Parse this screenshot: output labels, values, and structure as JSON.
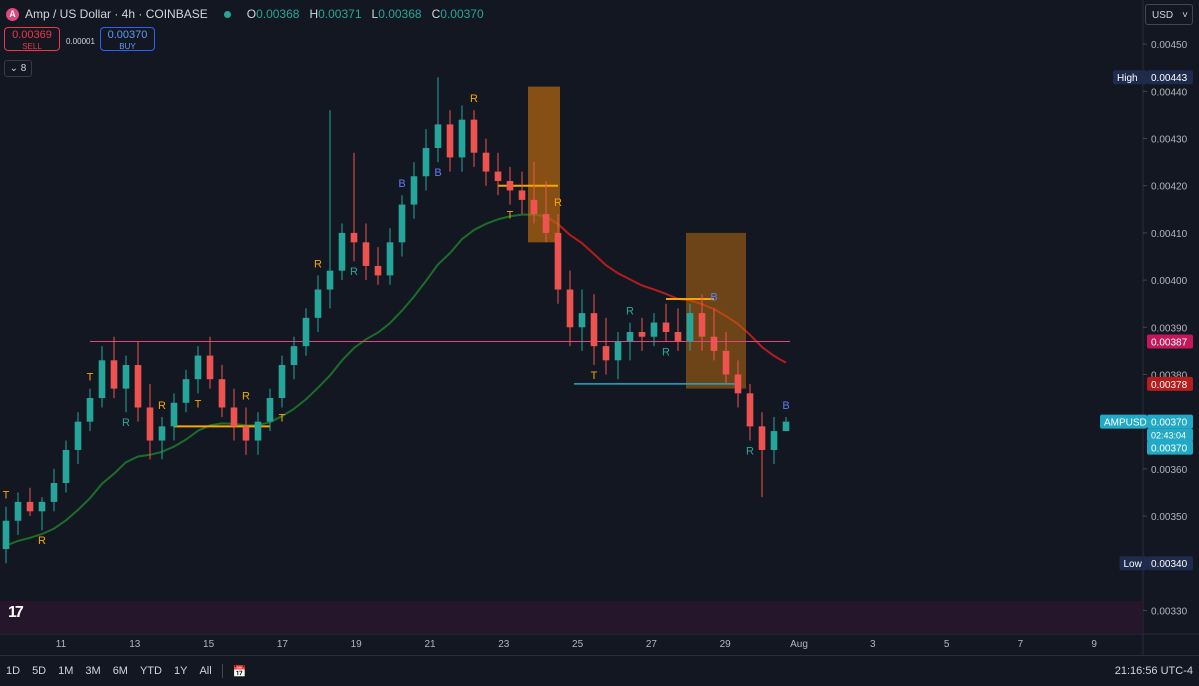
{
  "header": {
    "symbol_title": "Amp / US Dollar · 4h · COINBASE",
    "logo_letter": "A",
    "ohlc": [
      {
        "key": "O",
        "value": "0.00368"
      },
      {
        "key": "H",
        "value": "0.00371"
      },
      {
        "key": "L",
        "value": "0.00368"
      },
      {
        "key": "C",
        "value": "0.00370"
      }
    ]
  },
  "trade": {
    "sell_price": "0.00369",
    "sell_label": "SELL",
    "buy_price": "0.00370",
    "buy_label": "BUY",
    "spread": "0.00001"
  },
  "indicator_toggle": "8",
  "currency_select": "USD",
  "timeframes": [
    "1D",
    "5D",
    "1M",
    "3M",
    "6M",
    "YTD",
    "1Y",
    "All"
  ],
  "clock": "21:16:56 UTC-4",
  "colors": {
    "bg": "#131722",
    "up": "#26a69a",
    "down": "#ef5350",
    "gold": "#f7a600",
    "ema_green": "#1b6e2a",
    "ema_red": "#b71c1c",
    "magenta_line": "#e0457b",
    "cyan_line": "#22a9c5",
    "bands": "#b86a10"
  },
  "chart_data": {
    "type": "candlestick",
    "x_tick_labels": [
      "11",
      "13",
      "15",
      "17",
      "19",
      "21",
      "23",
      "25",
      "27",
      "29",
      "Aug",
      "3",
      "5",
      "7",
      "9"
    ],
    "y_tick_labels": [
      "0.00330",
      "0.00340",
      "0.00350",
      "0.00360",
      "0.00370",
      "0.00380",
      "0.00390",
      "0.00400",
      "0.00410",
      "0.00420",
      "0.00430",
      "0.00440",
      "0.00450"
    ],
    "ylim": [
      0.00325,
      0.00453
    ],
    "price_tags": [
      {
        "label": "High",
        "value": "0.00443"
      },
      {
        "label": "",
        "value": "0.00387"
      },
      {
        "label": "",
        "value": "0.00378"
      },
      {
        "label": "AMPUSD",
        "value": "0.00370",
        "countdown": "02:43:04"
      },
      {
        "label": "",
        "value": "0.00370"
      },
      {
        "label": "Low",
        "value": "0.00340"
      }
    ],
    "candles": [
      [
        0.00343,
        0.00352,
        0.0034,
        0.00349
      ],
      [
        0.00349,
        0.00355,
        0.00346,
        0.00353
      ],
      [
        0.00353,
        0.00356,
        0.0035,
        0.00351
      ],
      [
        0.00351,
        0.00354,
        0.00347,
        0.00353
      ],
      [
        0.00353,
        0.0036,
        0.00351,
        0.00357
      ],
      [
        0.00357,
        0.00366,
        0.00355,
        0.00364
      ],
      [
        0.00364,
        0.00372,
        0.00361,
        0.0037
      ],
      [
        0.0037,
        0.00377,
        0.00368,
        0.00375
      ],
      [
        0.00375,
        0.00386,
        0.00373,
        0.00383
      ],
      [
        0.00383,
        0.00388,
        0.00375,
        0.00377
      ],
      [
        0.00377,
        0.00384,
        0.00372,
        0.00382
      ],
      [
        0.00382,
        0.00387,
        0.0037,
        0.00373
      ],
      [
        0.00373,
        0.00378,
        0.00362,
        0.00366
      ],
      [
        0.00366,
        0.00371,
        0.00362,
        0.00369
      ],
      [
        0.00369,
        0.00376,
        0.00366,
        0.00374
      ],
      [
        0.00374,
        0.00381,
        0.00372,
        0.00379
      ],
      [
        0.00379,
        0.00386,
        0.00376,
        0.00384
      ],
      [
        0.00384,
        0.00388,
        0.00377,
        0.00379
      ],
      [
        0.00379,
        0.00382,
        0.00371,
        0.00373
      ],
      [
        0.00373,
        0.00377,
        0.00366,
        0.00369
      ],
      [
        0.00369,
        0.00373,
        0.00363,
        0.00366
      ],
      [
        0.00366,
        0.00372,
        0.00363,
        0.0037
      ],
      [
        0.0037,
        0.00377,
        0.00368,
        0.00375
      ],
      [
        0.00375,
        0.00384,
        0.00373,
        0.00382
      ],
      [
        0.00382,
        0.00388,
        0.00379,
        0.00386
      ],
      [
        0.00386,
        0.00394,
        0.00384,
        0.00392
      ],
      [
        0.00392,
        0.00401,
        0.00389,
        0.00398
      ],
      [
        0.00398,
        0.00436,
        0.00394,
        0.00402
      ],
      [
        0.00402,
        0.00412,
        0.004,
        0.0041
      ],
      [
        0.0041,
        0.00427,
        0.00404,
        0.00408
      ],
      [
        0.00408,
        0.00412,
        0.004,
        0.00403
      ],
      [
        0.00403,
        0.00407,
        0.00399,
        0.00401
      ],
      [
        0.00401,
        0.00411,
        0.00399,
        0.00408
      ],
      [
        0.00408,
        0.00418,
        0.00405,
        0.00416
      ],
      [
        0.00416,
        0.00425,
        0.00413,
        0.00422
      ],
      [
        0.00422,
        0.00432,
        0.00419,
        0.00428
      ],
      [
        0.00428,
        0.00443,
        0.00425,
        0.00433
      ],
      [
        0.00433,
        0.00436,
        0.00423,
        0.00426
      ],
      [
        0.00426,
        0.00437,
        0.00423,
        0.00434
      ],
      [
        0.00434,
        0.00436,
        0.00424,
        0.00427
      ],
      [
        0.00427,
        0.0043,
        0.0042,
        0.00423
      ],
      [
        0.00423,
        0.00427,
        0.00418,
        0.00421
      ],
      [
        0.00421,
        0.00424,
        0.00416,
        0.00419
      ],
      [
        0.00419,
        0.00423,
        0.00414,
        0.00417
      ],
      [
        0.00417,
        0.00425,
        0.00412,
        0.00414
      ],
      [
        0.00414,
        0.00421,
        0.00408,
        0.0041
      ],
      [
        0.0041,
        0.00414,
        0.00395,
        0.00398
      ],
      [
        0.00398,
        0.00402,
        0.00386,
        0.0039
      ],
      [
        0.0039,
        0.00398,
        0.00385,
        0.00393
      ],
      [
        0.00393,
        0.00397,
        0.00382,
        0.00386
      ],
      [
        0.00386,
        0.00392,
        0.0038,
        0.00383
      ],
      [
        0.00383,
        0.00389,
        0.00379,
        0.00387
      ],
      [
        0.00387,
        0.00391,
        0.00383,
        0.00389
      ],
      [
        0.00389,
        0.00392,
        0.00385,
        0.00388
      ],
      [
        0.00388,
        0.00393,
        0.00386,
        0.00391
      ],
      [
        0.00391,
        0.00395,
        0.00387,
        0.00389
      ],
      [
        0.00389,
        0.00394,
        0.00385,
        0.00387
      ],
      [
        0.00387,
        0.00395,
        0.00385,
        0.00393
      ],
      [
        0.00393,
        0.00397,
        0.00385,
        0.00388
      ],
      [
        0.00388,
        0.00394,
        0.00383,
        0.00385
      ],
      [
        0.00385,
        0.00389,
        0.00378,
        0.0038
      ],
      [
        0.0038,
        0.00383,
        0.00373,
        0.00376
      ],
      [
        0.00376,
        0.00378,
        0.00366,
        0.00369
      ],
      [
        0.00369,
        0.00372,
        0.00354,
        0.00364
      ],
      [
        0.00364,
        0.00371,
        0.00361,
        0.00368
      ],
      [
        0.00368,
        0.00371,
        0.00368,
        0.0037
      ]
    ],
    "signal_labels": [
      {
        "text": "T",
        "color": "gold"
      },
      {
        "text": "R",
        "color": "gold"
      },
      {
        "text": "T",
        "color": "gold"
      },
      {
        "text": "R",
        "color": "up"
      },
      {
        "text": "R",
        "color": "gold"
      },
      {
        "text": "T",
        "color": "gold"
      },
      {
        "text": "R",
        "color": "gold"
      },
      {
        "text": "T",
        "color": "gold"
      },
      {
        "text": "R",
        "color": "gold"
      },
      {
        "text": "R",
        "color": "up"
      },
      {
        "text": "B",
        "color": "blue"
      },
      {
        "text": "B",
        "color": "blue"
      },
      {
        "text": "R",
        "color": "gold"
      },
      {
        "text": "T",
        "color": "gold"
      },
      {
        "text": "R",
        "color": "gold"
      },
      {
        "text": "T",
        "color": "gold"
      },
      {
        "text": "R",
        "color": "up"
      },
      {
        "text": "R",
        "color": "up"
      },
      {
        "text": "B",
        "color": "blue"
      },
      {
        "text": "R",
        "color": "up"
      },
      {
        "text": "B",
        "color": "blue"
      }
    ]
  }
}
